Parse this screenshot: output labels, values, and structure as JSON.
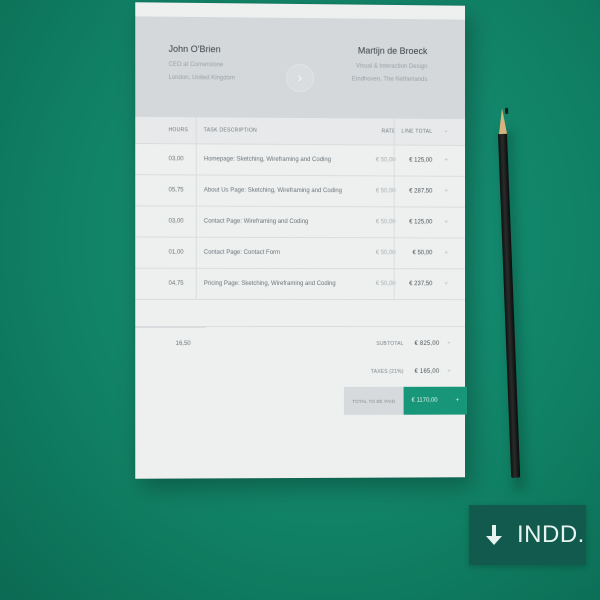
{
  "invoice": {
    "sender": {
      "name": "John O'Brien",
      "line1": "CEO at Cornerstone",
      "line2": "London, United Kingdom"
    },
    "recipient": {
      "name": "Martijn de Broeck",
      "line1": "Visual & Interaction Design",
      "line2": "Eindhoven, The Netherlands"
    },
    "columns": {
      "hours": "HOURS",
      "description": "TASK DESCRIPTION",
      "rate": "RATE",
      "line_total": "LINE TOTAL"
    },
    "rows": [
      {
        "hours": "03,00",
        "description": "Homepage: Sketching, Wireframing and Coding",
        "rate": "€ 50,00",
        "total": "€ 125,00"
      },
      {
        "hours": "05,75",
        "description": "About Us Page: Sketching, Wireframing and Coding",
        "rate": "€ 50,00",
        "total": "€ 287,50"
      },
      {
        "hours": "03,00",
        "description": "Contact Page: Wireframing and Coding",
        "rate": "€ 50,00",
        "total": "€ 125,00"
      },
      {
        "hours": "01,00",
        "description": "Contact Page: Contact Form",
        "rate": "€ 50,00",
        "total": "€ 50,00"
      },
      {
        "hours": "04,75",
        "description": "Pricing Page: Sketching, Wireframing and Coding",
        "rate": "€ 50,00",
        "total": "€ 237,50"
      }
    ],
    "hours_total": "16,50",
    "subtotal_label": "SUBTOTAL",
    "subtotal": "€ 825,00",
    "taxes_label": "TAXES (21%)",
    "taxes": "€ 165,00",
    "total_label": "TOTAL TO BE PAID",
    "total": "€ 1170,00",
    "plus_symbol": "+",
    "arrow_symbol": "›"
  },
  "badge": {
    "label": "INDD.",
    "icon": "download-arrow-icon"
  },
  "colors": {
    "background": "#117f67",
    "accent": "#17967a",
    "badge": "#125a4e"
  }
}
